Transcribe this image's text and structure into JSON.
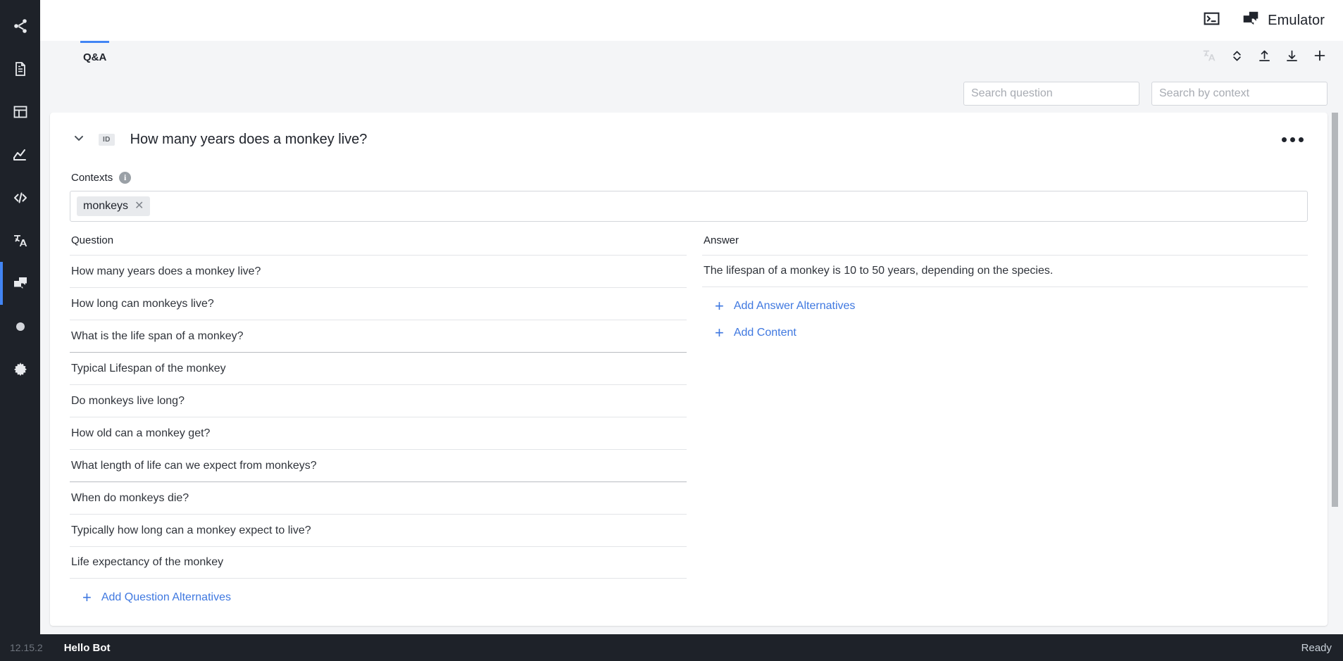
{
  "sidebar": {
    "items": [
      {
        "name": "share-icon",
        "label": "Share",
        "active": false
      },
      {
        "name": "document-icon",
        "label": "Scripts",
        "active": false
      },
      {
        "name": "layout-icon",
        "label": "Layouts",
        "active": false
      },
      {
        "name": "analytics-icon",
        "label": "Analytics",
        "active": false
      },
      {
        "name": "code-icon",
        "label": "Code",
        "active": false
      },
      {
        "name": "translate-icon",
        "label": "Localization",
        "active": false
      },
      {
        "name": "chat-icon",
        "label": "Q&A",
        "active": true
      },
      {
        "name": "circle-icon",
        "label": "Record",
        "active": false
      },
      {
        "name": "gear-icon",
        "label": "Settings",
        "active": false
      }
    ]
  },
  "topbar": {
    "terminal_icon": "terminal-icon",
    "emulator_icon": "chat-bubbles-icon",
    "emulator_label": "Emulator"
  },
  "tabs": [
    {
      "label": "Q&A",
      "active": true
    }
  ],
  "tab_actions": [
    {
      "name": "translate-icon",
      "label": "Translate",
      "disabled": true
    },
    {
      "name": "expand-collapse-icon",
      "label": "Expand / Collapse",
      "disabled": false
    },
    {
      "name": "upload-icon",
      "label": "Import",
      "disabled": false
    },
    {
      "name": "download-icon",
      "label": "Export",
      "disabled": false
    },
    {
      "name": "plus-icon",
      "label": "Add",
      "disabled": false
    }
  ],
  "search": {
    "question_placeholder": "Search question",
    "question_value": "",
    "context_placeholder": "Search by context",
    "context_value": ""
  },
  "qa_item": {
    "id_badge": "ID",
    "title": "How many years does a monkey live?",
    "more_label": "•••",
    "contexts_label": "Contexts",
    "info_glyph": "i",
    "contexts": [
      {
        "label": "monkeys",
        "remove_glyph": "✕"
      }
    ],
    "question_column_header": "Question",
    "questions": [
      {
        "text": "How many years does a monkey live?",
        "divider": "light"
      },
      {
        "text": "How long can monkeys live?",
        "divider": "light"
      },
      {
        "text": "What is the life span of a monkey?",
        "divider": "light"
      },
      {
        "text": "Typical Lifespan of the monkey",
        "divider": "strong"
      },
      {
        "text": "Do monkeys live long?",
        "divider": "light"
      },
      {
        "text": "How old can a monkey get?",
        "divider": "light"
      },
      {
        "text": "What length of life can we expect from monkeys?",
        "divider": "light"
      },
      {
        "text": "When do monkeys die?",
        "divider": "strong"
      },
      {
        "text": "Typically how long can a monkey expect to live?",
        "divider": "light"
      },
      {
        "text": "Life expectancy of the monkey",
        "divider": "light"
      }
    ],
    "add_question_alternatives": "Add Question Alternatives",
    "answer_column_header": "Answer",
    "answers": [
      {
        "text": "The lifespan of a monkey is 10 to 50 years, depending on the species."
      }
    ],
    "add_answer_alternatives": "Add Answer Alternatives",
    "add_content": "Add Content",
    "plus_glyph": "+"
  },
  "statusbar": {
    "version": "12.15.2",
    "bot_name": "Hello Bot",
    "status": "Ready"
  },
  "colors": {
    "sidebar_bg": "#1e2229",
    "accent_blue": "#4285f4",
    "link_blue": "#3f78e0",
    "page_bg": "#f4f5f7",
    "card_bg": "#ffffff",
    "text": "#20242c"
  }
}
